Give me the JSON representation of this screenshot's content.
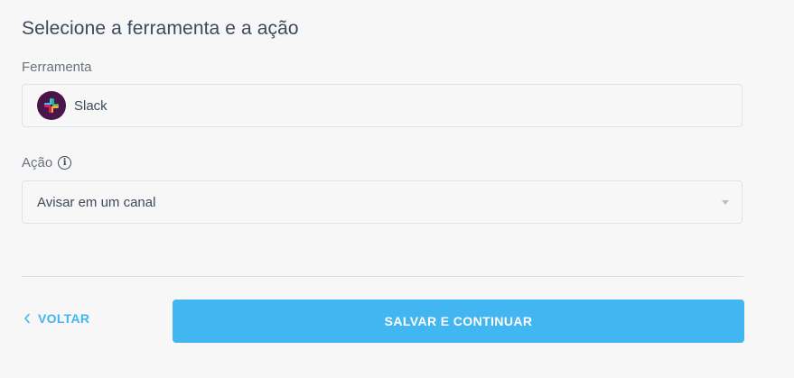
{
  "page": {
    "title": "Selecione a ferramenta e a ação"
  },
  "tool": {
    "label": "Ferramenta",
    "value": "Slack",
    "icon": "slack-logo"
  },
  "action": {
    "label": "Ação",
    "info_icon": "info-icon",
    "value": "Avisar em um canal",
    "caret_icon": "caret-down-icon"
  },
  "footer": {
    "back_label": "VOLTAR",
    "back_icon": "chevron-left-icon",
    "save_label": "SALVAR E CONTINUAR"
  },
  "colors": {
    "accent": "#41b6f0",
    "slack_bg": "#4a154b",
    "text": "#3c4a5c",
    "background": "#f7f7f7"
  }
}
